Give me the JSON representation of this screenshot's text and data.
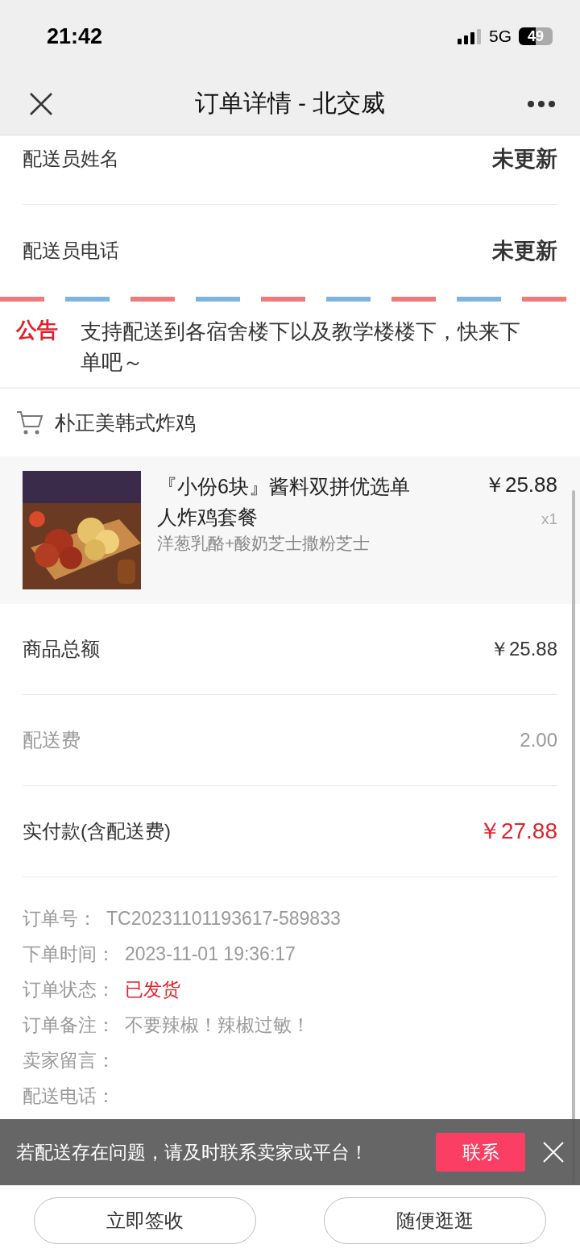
{
  "status_bar": {
    "time": "21:42",
    "network": "5G",
    "battery": "49"
  },
  "nav": {
    "title": "订单详情 - 北交威"
  },
  "courier": [
    {
      "label": "配送员姓名",
      "value": "未更新"
    },
    {
      "label": "配送员电话",
      "value": "未更新"
    }
  ],
  "notice": {
    "tag": "公告",
    "text": "支持配送到各宿舍楼下以及教学楼楼下，快来下单吧～"
  },
  "shop": {
    "name": "朴正美韩式炸鸡"
  },
  "items": [
    {
      "kind": "picture",
      "title": "『小份6块』酱料双拼优选单人炸鸡套餐",
      "spec": "洋葱乳酪+酸奶芝士撒粉芝士",
      "price": "￥25.88",
      "quantity": "x1"
    }
  ],
  "summary": [
    {
      "kind": "subtotal",
      "label": "商品总额",
      "value": "￥25.88"
    },
    {
      "kind": "fee",
      "label": "配送费",
      "value": "2.00"
    },
    {
      "kind": "total",
      "label": "实付款(含配送费)",
      "value": "￥27.88"
    }
  ],
  "info": [
    {
      "label": "订单号：",
      "value": "TC20231101193617-589833",
      "kind": "text"
    },
    {
      "label": "下单时间：",
      "value": "2023-11-01 19:36:17",
      "kind": "text"
    },
    {
      "label": "订单状态：",
      "value": "已发货",
      "kind": "status"
    },
    {
      "label": "订单备注：",
      "value": "不要辣椒！辣椒过敏！",
      "kind": "text"
    },
    {
      "label": "卖家留言："
    },
    {
      "label": "配送电话："
    }
  ],
  "banner": {
    "text": "若配送存在问题，请及时联系卖家或平台！",
    "button": "联系"
  },
  "buttons": [
    "立即签收",
    "随便逛逛"
  ]
}
